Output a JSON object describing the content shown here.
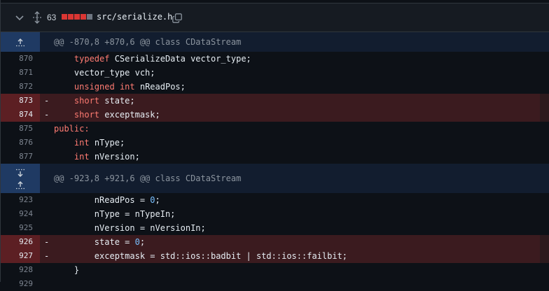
{
  "file": {
    "changes_count": "63",
    "name": "src/serialize.h",
    "diffstat": [
      "red",
      "red",
      "red",
      "red",
      "gray"
    ]
  },
  "hunks": [
    {
      "header": "@@ -870,8 +870,6 @@ class CDataStream",
      "lines": [
        {
          "num": "870",
          "type": "ctx",
          "sign": "",
          "indent": "    ",
          "tokens": [
            {
              "t": "typedef",
              "c": "kw"
            },
            {
              "t": " CSerializeData vector_type;",
              "c": "plain"
            }
          ]
        },
        {
          "num": "871",
          "type": "ctx",
          "sign": "",
          "indent": "    ",
          "tokens": [
            {
              "t": "vector_type vch;",
              "c": "plain"
            }
          ]
        },
        {
          "num": "872",
          "type": "ctx",
          "sign": "",
          "indent": "    ",
          "tokens": [
            {
              "t": "unsigned",
              "c": "kw"
            },
            {
              "t": " ",
              "c": "plain"
            },
            {
              "t": "int",
              "c": "kw"
            },
            {
              "t": " nReadPos;",
              "c": "plain"
            }
          ]
        },
        {
          "num": "873",
          "type": "del",
          "sign": "-",
          "indent": "    ",
          "tokens": [
            {
              "t": "short",
              "c": "kw"
            },
            {
              "t": " state;",
              "c": "plain"
            }
          ]
        },
        {
          "num": "874",
          "type": "del",
          "sign": "-",
          "indent": "    ",
          "tokens": [
            {
              "t": "short",
              "c": "kw"
            },
            {
              "t": " exceptmask;",
              "c": "plain"
            }
          ]
        },
        {
          "num": "875",
          "type": "ctx",
          "sign": "",
          "indent": "",
          "tokens": [
            {
              "t": "public:",
              "c": "kw"
            }
          ]
        },
        {
          "num": "876",
          "type": "ctx",
          "sign": "",
          "indent": "    ",
          "tokens": [
            {
              "t": "int",
              "c": "kw"
            },
            {
              "t": " nType;",
              "c": "plain"
            }
          ]
        },
        {
          "num": "877",
          "type": "ctx",
          "sign": "",
          "indent": "    ",
          "tokens": [
            {
              "t": "int",
              "c": "kw"
            },
            {
              "t": " nVersion;",
              "c": "plain"
            }
          ]
        }
      ]
    },
    {
      "header": "@@ -923,8 +921,6 @@ class CDataStream",
      "lines": [
        {
          "num": "923",
          "type": "ctx",
          "sign": "",
          "indent": "        ",
          "tokens": [
            {
              "t": "nReadPos = ",
              "c": "plain"
            },
            {
              "t": "0",
              "c": "num"
            },
            {
              "t": ";",
              "c": "plain"
            }
          ]
        },
        {
          "num": "924",
          "type": "ctx",
          "sign": "",
          "indent": "        ",
          "tokens": [
            {
              "t": "nType = nTypeIn;",
              "c": "plain"
            }
          ]
        },
        {
          "num": "925",
          "type": "ctx",
          "sign": "",
          "indent": "        ",
          "tokens": [
            {
              "t": "nVersion = nVersionIn;",
              "c": "plain"
            }
          ]
        },
        {
          "num": "926",
          "type": "del",
          "sign": "-",
          "indent": "        ",
          "tokens": [
            {
              "t": "state = ",
              "c": "plain"
            },
            {
              "t": "0",
              "c": "num"
            },
            {
              "t": ";",
              "c": "plain"
            }
          ]
        },
        {
          "num": "927",
          "type": "del",
          "sign": "-",
          "indent": "        ",
          "tokens": [
            {
              "t": "exceptmask = std::ios::badbit | std::ios::failbit;",
              "c": "plain"
            }
          ]
        },
        {
          "num": "928",
          "type": "ctx",
          "sign": "",
          "indent": "    ",
          "tokens": [
            {
              "t": "}",
              "c": "plain"
            }
          ]
        },
        {
          "num": "929",
          "type": "ctx",
          "sign": "",
          "indent": "",
          "tokens": []
        }
      ]
    }
  ],
  "colors": {
    "background": "#0d1117",
    "deletion": "#3b1b1f",
    "hunk_gutter": "#1f3a63",
    "keyword": "#ff7b72"
  }
}
